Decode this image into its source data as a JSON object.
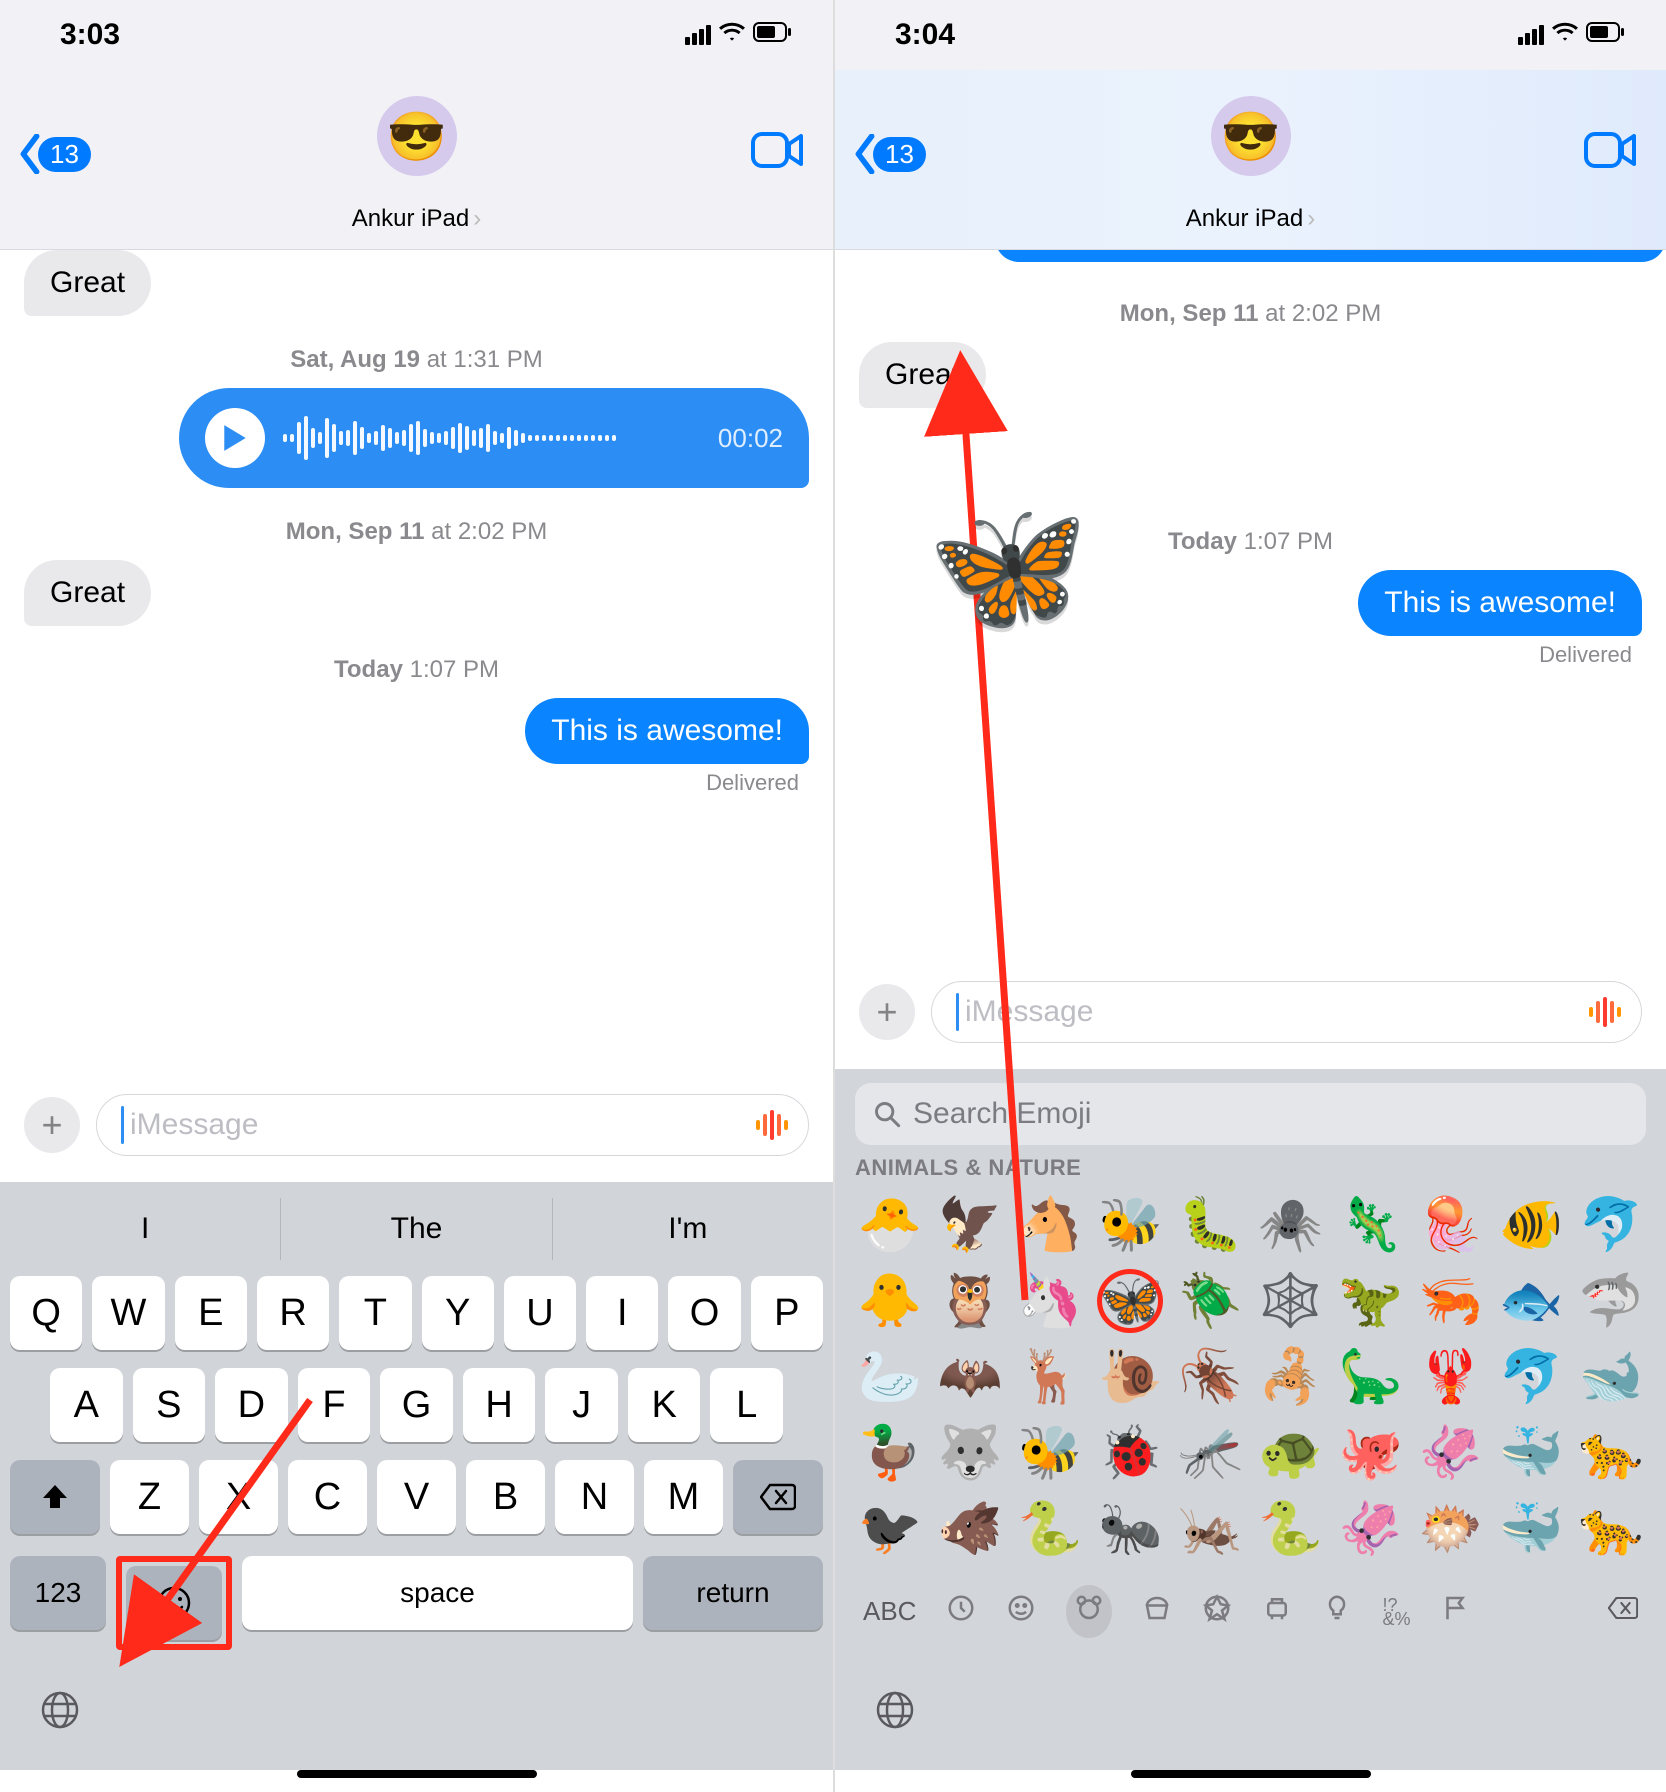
{
  "left": {
    "time": "3:03",
    "back_count": "13",
    "contact": "Ankur iPad",
    "avatar": "😎",
    "ts1": "Sat, Aug 19 at 1:31 PM",
    "audio_duration": "00:02",
    "ts2": "Mon, Sep 11 at 2:02 PM",
    "great": "Great",
    "great0": "Great",
    "ts3": "Today 1:07 PM",
    "sent": "This is awesome!",
    "delivered": "Delivered",
    "placeholder": "iMessage",
    "sugg": [
      "I",
      "The",
      "I'm"
    ],
    "row1": [
      "Q",
      "W",
      "E",
      "R",
      "T",
      "Y",
      "U",
      "I",
      "O",
      "P"
    ],
    "row2": [
      "A",
      "S",
      "D",
      "F",
      "G",
      "H",
      "J",
      "K",
      "L"
    ],
    "row3": [
      "Z",
      "X",
      "C",
      "V",
      "B",
      "N",
      "M"
    ],
    "numkey": "123",
    "space": "space",
    "return": "return"
  },
  "right": {
    "time": "3:04",
    "back_count": "13",
    "contact": "Ankur iPad",
    "avatar": "😎",
    "ts1": "Mon, Sep 11 at 2:02 PM",
    "great": "Great",
    "ts2": "Today 1:07 PM",
    "sent": "This is awesome!",
    "delivered": "Delivered",
    "placeholder": "iMessage",
    "search_placeholder": "Search Emoji",
    "category": "ANIMALS & NATURE",
    "abc": "ABC",
    "butterfly": "🦋",
    "emoji_grid": [
      "🐣",
      "🦅",
      "🐴",
      "🐝",
      "🐛",
      "🕷️",
      "🦎",
      "🪼",
      "🐠",
      "🐬",
      "🐥",
      "🦉",
      "🦄",
      "🦋",
      "🪲",
      "🕸️",
      "🦖",
      "🦐",
      "🐟",
      "🦈",
      "🦢",
      "🦇",
      "🦌",
      "🐌",
      "🪳",
      "🦂",
      "🦕",
      "🦞",
      "🐬",
      "🐋",
      "🦆",
      "🐺",
      "🐝",
      "🐞",
      "🦟",
      "🐢",
      "🐙",
      "🦑",
      "🐳",
      "🐆",
      "🐦‍⬛",
      "🐗",
      "🐍",
      "🐜",
      "🦗",
      "🐍",
      "🦑",
      "🐡",
      "🐳",
      "🐆"
    ]
  }
}
